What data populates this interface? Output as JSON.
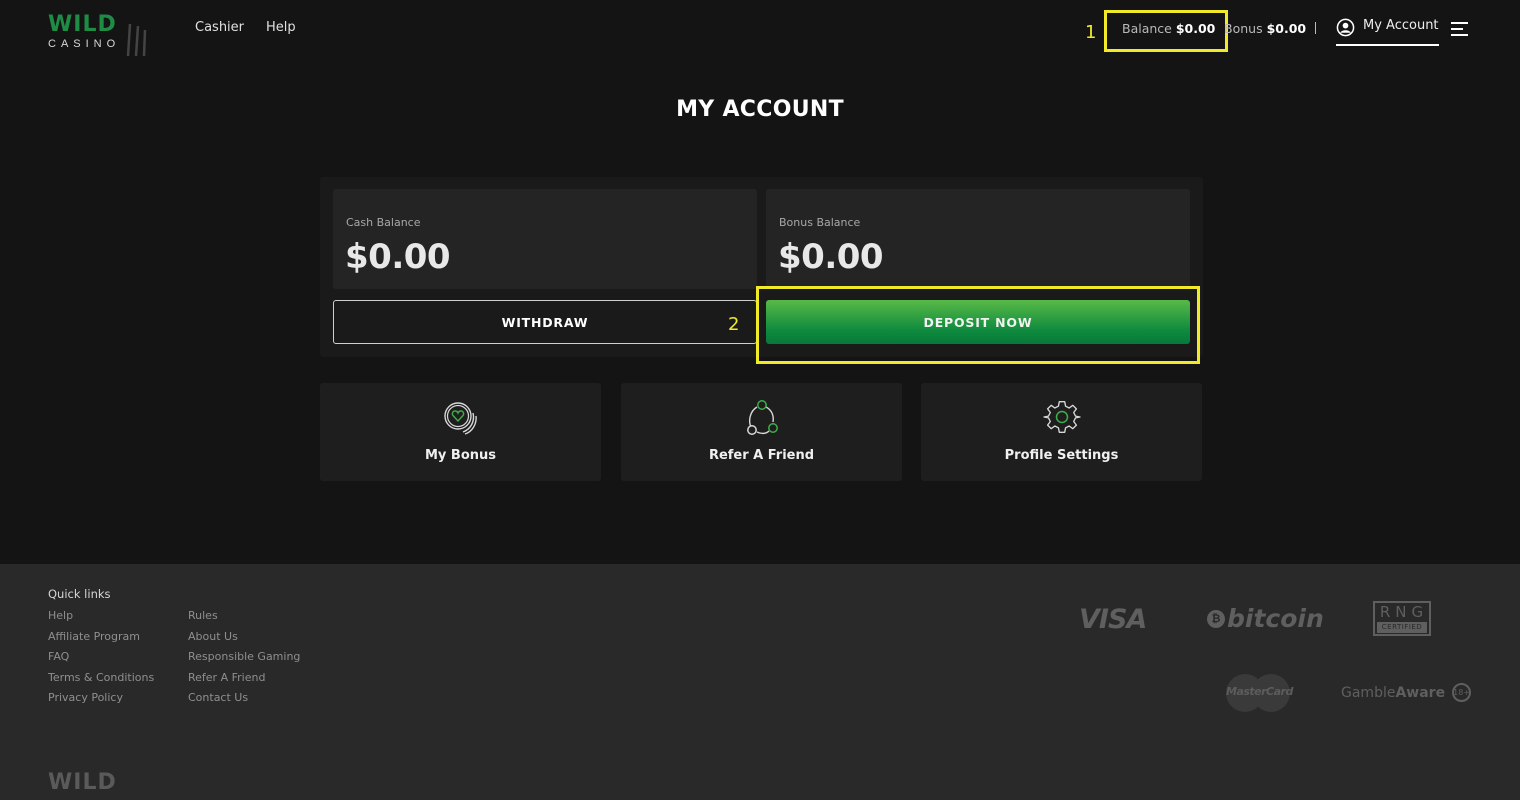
{
  "header": {
    "logo_top": "WILD",
    "logo_bottom": "CASINO",
    "nav": [
      {
        "label": "Cashier"
      },
      {
        "label": "Help"
      }
    ],
    "balance_label": "Balance",
    "balance_value": "$0.00",
    "bonus_label": "Bonus",
    "bonus_value": "$0.00",
    "account_label": "My Account",
    "user_icon": "user-circle-icon",
    "menu_icon": "hamburger-menu-icon"
  },
  "annotations": {
    "marker_1": "1",
    "marker_2": "2",
    "highlight_color": "#f1ea29"
  },
  "page": {
    "title": "MY ACCOUNT"
  },
  "balances": {
    "cash": {
      "label": "Cash Balance",
      "value": "$0.00"
    },
    "bonus": {
      "label": "Bonus Balance",
      "value": "$0.00"
    },
    "withdraw_label": "WITHDRAW",
    "deposit_label": "DEPOSIT NOW",
    "accent_color": "#0e8a3e"
  },
  "tiles": [
    {
      "label": "My Bonus",
      "icon": "heart-coin-icon"
    },
    {
      "label": "Refer A Friend",
      "icon": "referral-network-icon"
    },
    {
      "label": "Profile Settings",
      "icon": "gear-icon"
    }
  ],
  "footer": {
    "quick_links_title": "Quick links",
    "col1": [
      "Help",
      "Affiliate Program",
      "FAQ",
      "Terms & Conditions",
      "Privacy Policy"
    ],
    "col2": [
      "Rules",
      "About Us",
      "Responsible Gaming",
      "Refer A Friend",
      "Contact Us"
    ],
    "payments": {
      "visa": "VISA",
      "bitcoin": "bitcoin",
      "bitcoin_symbol": "₿",
      "rng_top": "RNG",
      "rng_bottom": "CERTIFIED",
      "mastercard": "MasterCard",
      "gambleaware_a": "Gamble",
      "gambleaware_b": "Aware",
      "age": "18+"
    },
    "logo": "WILD"
  }
}
